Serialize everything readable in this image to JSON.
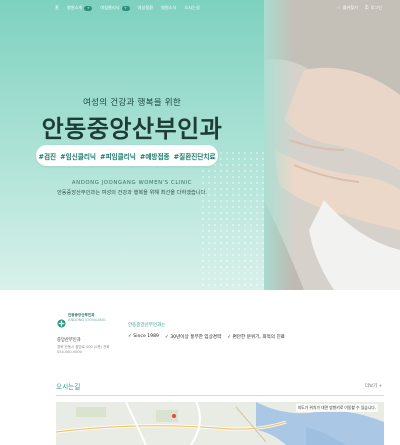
{
  "nav": {
    "items": [
      {
        "label": "홈",
        "badge": ""
      },
      {
        "label": "병원소개",
        "badge": "+"
      },
      {
        "label": "여성클리닉",
        "badge": "+"
      },
      {
        "label": "여성질환",
        "badge": ""
      },
      {
        "label": "병원소식",
        "badge": ""
      },
      {
        "label": "오시는길",
        "badge": ""
      }
    ],
    "right": {
      "bookmark": "즐겨찾기",
      "login": "로그인"
    }
  },
  "hero": {
    "subtitle": "여성의 건강과 행복을 위한",
    "title": "안동중앙산부인과",
    "tags": [
      "#검진",
      "#임신클리닉",
      "#피임클리닉",
      "#예방접종",
      "#질환진단치료"
    ],
    "english_name": "ANDONG JOONGANG WOMEN'S CLINIC",
    "description": "안동중앙산부인과는 여성의 건강과 행복을 위해 최선을 다하겠습니다."
  },
  "info": {
    "logo_line1": "안동중앙산부인과",
    "logo_line2": "ANDONG JOONGANG",
    "clinic_name": "중앙산부인과",
    "address": "경북 안동시 중앙로 000 (0층) 전화 054-000-0000",
    "label": "안동중앙산부인과는",
    "features": [
      "✓ Since 1989",
      "✓ 30년이상 풍부한 임상경력",
      "✓ 편안한 분위기, 최적의 진료"
    ]
  },
  "directions": {
    "title": "오시는길",
    "more": "더보기 +",
    "map_note": "지도가 위치가 대면 방향키로 이동할 수 있습니다."
  },
  "colors": {
    "accent": "#2b9a85",
    "hero_top": "#7ed1bf",
    "hero_bottom": "#d9f1ea"
  }
}
